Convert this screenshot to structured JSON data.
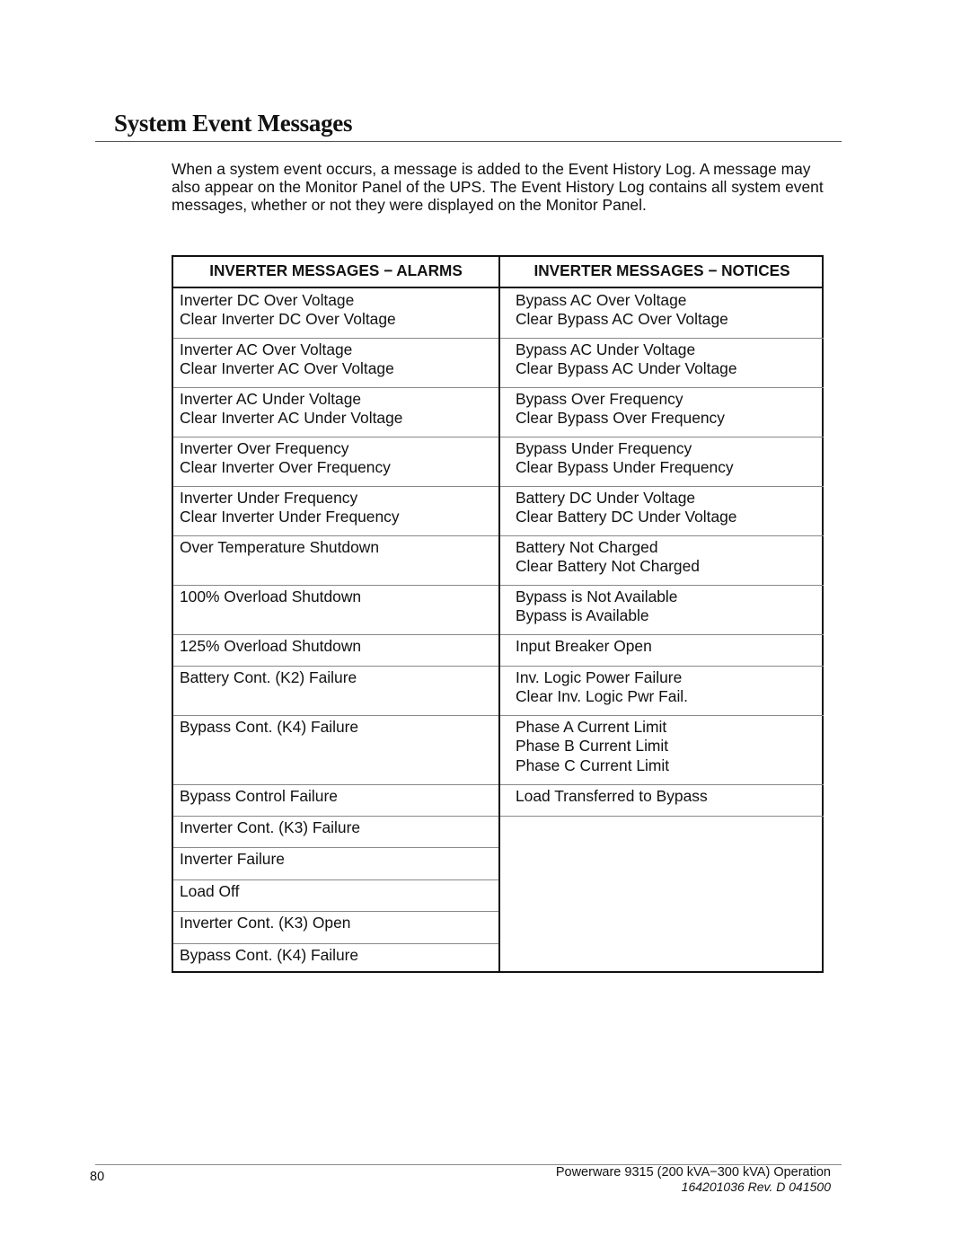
{
  "page": {
    "title": "System Event Messages",
    "intro": "When a system event occurs, a message is added to the Event History Log.  A message may also appear on the Monitor Panel of the UPS.  The Event History Log contains all system event messages, whether or not they were displayed on the Monitor Panel."
  },
  "table": {
    "headers": {
      "alarms": "INVERTER MESSAGES − ALARMS",
      "notices": "INVERTER MESSAGES − NOTICES"
    },
    "alarms": [
      [
        "Inverter DC Over Voltage",
        "Clear Inverter DC Over Voltage"
      ],
      [
        "Inverter AC Over Voltage",
        "Clear Inverter AC Over Voltage"
      ],
      [
        "Inverter AC Under Voltage",
        "Clear Inverter AC Under Voltage"
      ],
      [
        "Inverter Over Frequency",
        "Clear Inverter Over Frequency"
      ],
      [
        "Inverter Under Frequency",
        "Clear Inverter Under Frequency"
      ],
      [
        "Over Temperature Shutdown"
      ],
      [
        "100% Overload Shutdown"
      ],
      [
        "125% Overload Shutdown"
      ],
      [
        "Battery Cont. (K2) Failure"
      ],
      [
        "Bypass Cont. (K4) Failure"
      ],
      [
        "Bypass Control Failure"
      ],
      [
        "Inverter Cont. (K3) Failure"
      ],
      [
        "Inverter Failure"
      ],
      [
        "Load Off"
      ],
      [
        "Inverter Cont. (K3) Open"
      ],
      [
        "Bypass Cont. (K4) Failure"
      ]
    ],
    "notices": [
      [
        "Bypass AC Over Voltage",
        "Clear Bypass AC Over Voltage"
      ],
      [
        "Bypass AC Under Voltage",
        "Clear Bypass AC Under Voltage"
      ],
      [
        "Bypass Over Frequency",
        "Clear Bypass Over Frequency"
      ],
      [
        "Bypass Under Frequency",
        "Clear Bypass Under Frequency"
      ],
      [
        "Battery DC Under Voltage",
        "Clear Battery DC Under Voltage"
      ],
      [
        "Battery Not Charged",
        "Clear Battery Not Charged"
      ],
      [
        "Bypass is Not Available",
        "Bypass is Available"
      ],
      [
        "Input Breaker Open"
      ],
      [
        "Inv. Logic Power Failure",
        "Clear Inv. Logic Pwr Fail."
      ],
      [
        "Phase A Current Limit",
        "Phase B Current Limit",
        "Phase C Current Limit"
      ],
      [
        "Load Transferred to Bypass"
      ],
      []
    ]
  },
  "footer": {
    "page_number": "80",
    "doc_title": "Powerware 9315 (200 kVA−300 kVA) Operation",
    "doc_number": "164201036  Rev. D  041500"
  }
}
